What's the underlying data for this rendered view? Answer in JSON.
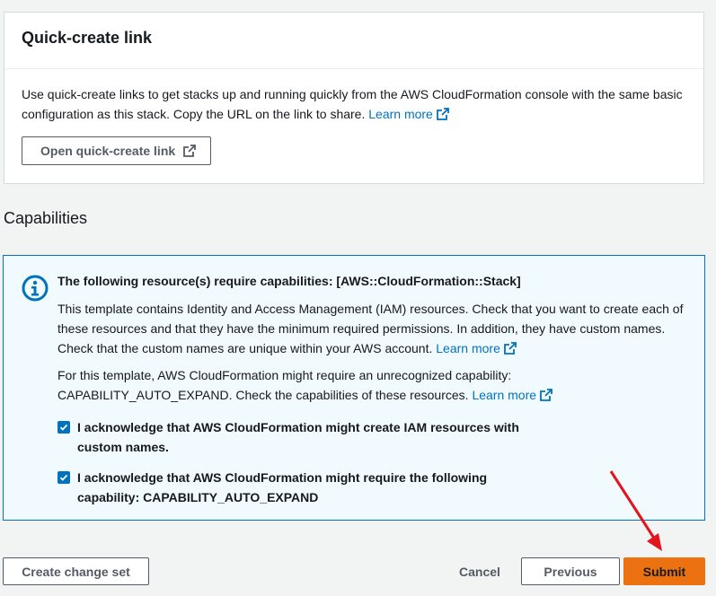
{
  "quick_create": {
    "title": "Quick-create link",
    "description": "Use quick-create links to get stacks up and running quickly from the AWS CloudFormation console with the same basic configuration as this stack. Copy the URL on the link to share.",
    "learn_more": "Learn more",
    "open_button": "Open quick-create link"
  },
  "capabilities": {
    "section_title": "Capabilities",
    "heading": "The following resource(s) require capabilities: [AWS::CloudFormation::Stack]",
    "para1": "This template contains Identity and Access Management (IAM) resources. Check that you want to create each of these resources and that they have the minimum required permissions. In addition, they have custom names. Check that the custom names are unique within your AWS account.",
    "para1_link": "Learn more",
    "para2": "For this template, AWS CloudFormation might require an unrecognized capability: CAPABILITY_AUTO_EXPAND. Check the capabilities of these resources.",
    "para2_link": "Learn more",
    "ack1": "I acknowledge that AWS CloudFormation might create IAM resources with custom names.",
    "ack2": "I acknowledge that AWS CloudFormation might require the following capability: CAPABILITY_AUTO_EXPAND",
    "ack1_checked": true,
    "ack2_checked": true
  },
  "footer": {
    "create_change_set": "Create change set",
    "cancel": "Cancel",
    "previous": "Previous",
    "submit": "Submit"
  },
  "colors": {
    "link": "#0073bb",
    "info_bg": "#f1faff",
    "submit_bg": "#ec7211",
    "annotation_arrow": "#e3141b"
  },
  "icons": [
    "external-link-icon",
    "info-icon",
    "checkmark-icon",
    "annotation-arrow"
  ]
}
